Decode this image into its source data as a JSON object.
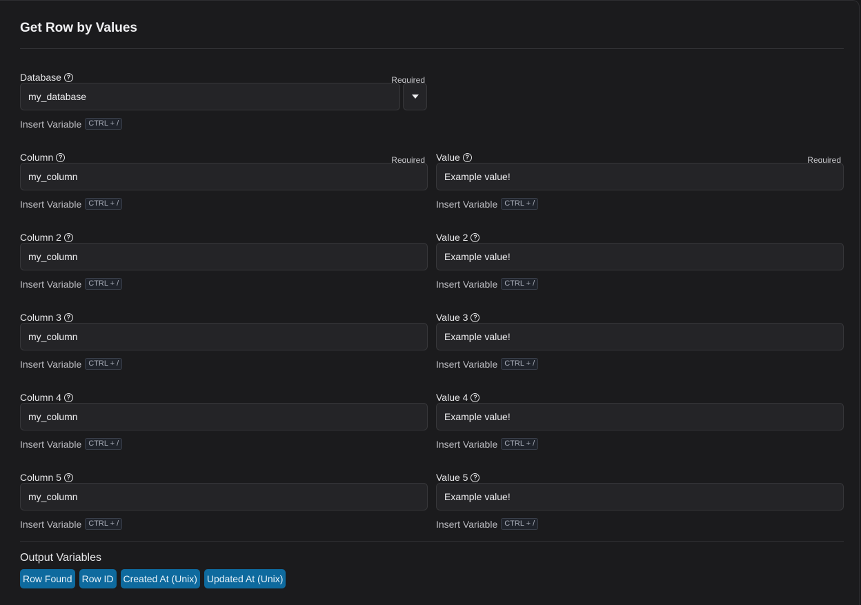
{
  "title": "Get Row by Values",
  "required_label": "Required",
  "insert_variable": {
    "label": "Insert Variable",
    "shortcut": "CTRL + /"
  },
  "database": {
    "label": "Database",
    "value": "my_database",
    "required": true
  },
  "pairs": [
    {
      "column_label": "Column",
      "column_value": "my_column",
      "value_label": "Value",
      "value_value": "Example value!",
      "required": true
    },
    {
      "column_label": "Column 2",
      "column_value": "my_column",
      "value_label": "Value 2",
      "value_value": "Example value!",
      "required": false
    },
    {
      "column_label": "Column 3",
      "column_value": "my_column",
      "value_label": "Value 3",
      "value_value": "Example value!",
      "required": false
    },
    {
      "column_label": "Column 4",
      "column_value": "my_column",
      "value_label": "Value 4",
      "value_value": "Example value!",
      "required": false
    },
    {
      "column_label": "Column 5",
      "column_value": "my_column",
      "value_label": "Value 5",
      "value_value": "Example value!",
      "required": false
    }
  ],
  "output": {
    "title": "Output Variables",
    "variables": [
      "Row Found",
      "Row ID",
      "Created At (Unix)",
      "Updated At (Unix)"
    ]
  },
  "colors": {
    "chip_bg": "#0e6a9e",
    "background": "#1b1b1d"
  }
}
